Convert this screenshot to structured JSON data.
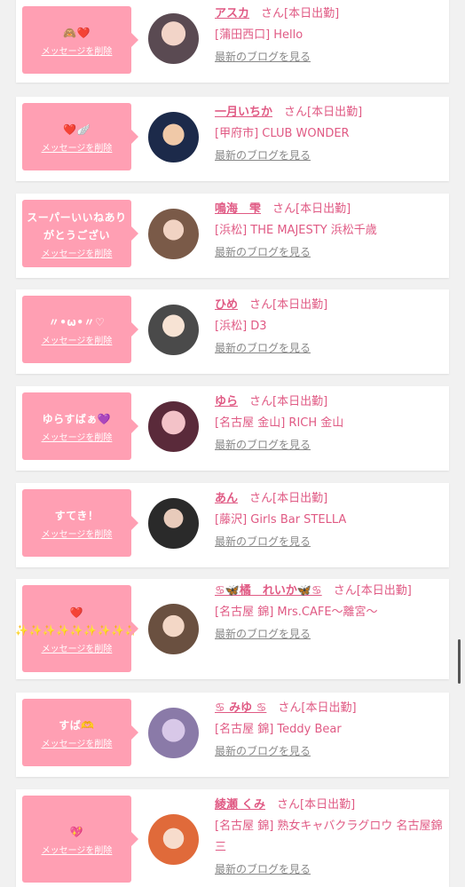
{
  "labels": {
    "delete": "メッセージを削除",
    "blog": "最新のブログを見る"
  },
  "colors": {
    "bubble": "#ff9fb3",
    "accent": "#e05a84",
    "link": "#888888",
    "background": "#f1f1f1"
  },
  "cards": [
    {
      "message": "🙈❤️",
      "name": "アスカ",
      "suffix": "さん[本日出勤]",
      "store": "[蒲田西口] Hello"
    },
    {
      "message": "❤️🪽",
      "name": "一月いちか",
      "suffix": "さん[本日出勤]",
      "store": "[甲府市] CLUB WONDER"
    },
    {
      "message": "スーパーいいねありがとうござい",
      "name": "鳴海　雫",
      "suffix": "さん[本日出勤]",
      "store": "[浜松] THE MAJESTY 浜松千歳"
    },
    {
      "message": "〃•ω•〃♡",
      "name": "ひめ",
      "suffix": "さん[本日出勤]",
      "store": "[浜松] D3"
    },
    {
      "message": "ゆらすばぁ💜",
      "name": "ゆら",
      "suffix": "さん[本日出勤]",
      "store": "[名古屋 金山] RICH 金山"
    },
    {
      "message": "すてき！",
      "name": "あん",
      "suffix": "さん[本日出勤]",
      "store": "[藤沢] Girls Bar STELLA"
    },
    {
      "message": "❤️✨✨✨✨✨✨✨✨✨",
      "name": "♋🦋橘　れいか🦋♋",
      "suffix": "さん[本日出勤]",
      "store": "[名古屋 錦] Mrs.CAFE〜離宮〜"
    },
    {
      "message": "すば🫶",
      "name": "♋ みゆ ♋",
      "suffix": "さん[本日出勤]",
      "store": "[名古屋 錦] Teddy Bear"
    },
    {
      "message": "💖",
      "name": "綾瀬 くみ",
      "suffix": "さん[本日出勤]",
      "store": "[名古屋 錦] 熟女キャバクラグロウ 名古屋錦三"
    }
  ]
}
